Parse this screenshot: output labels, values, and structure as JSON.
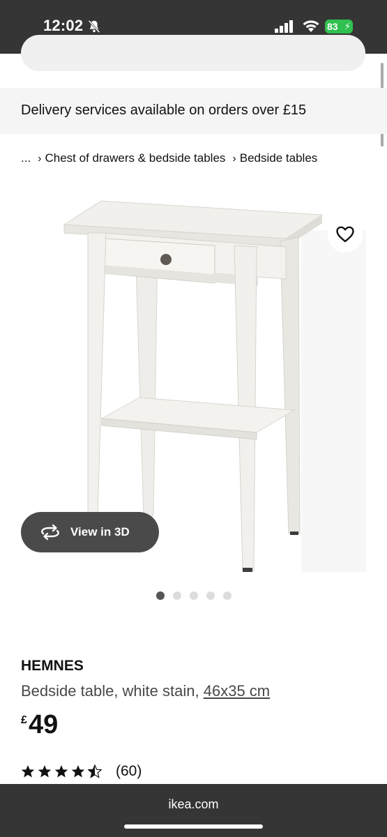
{
  "status_bar": {
    "time": "12:02",
    "battery": "83",
    "icons": [
      "bell-slash-icon",
      "signal-icon",
      "wifi-icon",
      "battery-icon"
    ]
  },
  "banner": {
    "text": "Delivery services available on orders over £15"
  },
  "breadcrumb": {
    "items": [
      "...",
      "Chest of drawers & bedside tables",
      "Bedside tables"
    ]
  },
  "gallery": {
    "view3d_label": "View in 3D",
    "dot_count": 5,
    "active_dot": 0
  },
  "product": {
    "name": "HEMNES",
    "description": "Bedside table, white stain,",
    "size": "46x35 cm",
    "currency": "£",
    "price": "49",
    "rating_value": 4.5,
    "rating_count": "(60)"
  },
  "browser": {
    "url": "ikea.com"
  },
  "colors": {
    "chrome": "#353535",
    "battery": "#30c04f",
    "button_dark": "#4a4a4a",
    "banner_bg": "#f5f5f5"
  }
}
